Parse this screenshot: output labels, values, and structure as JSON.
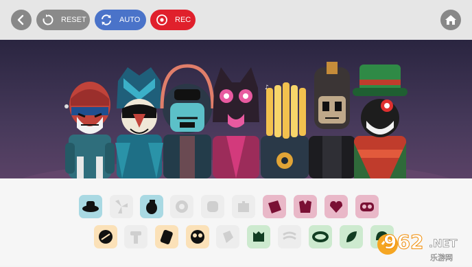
{
  "toolbar": {
    "reset_label": "RESET",
    "auto_label": "AUTO",
    "rec_label": "REC",
    "reset_color": "#8a8a8a",
    "auto_color": "#4a73c9",
    "rec_color": "#e0202c"
  },
  "stage": {
    "characters": [
      {
        "id": "c1",
        "role": "beats"
      },
      {
        "id": "c2",
        "role": "beats"
      },
      {
        "id": "c3",
        "role": "beats"
      },
      {
        "id": "c4",
        "role": "effects"
      },
      {
        "id": "c5",
        "role": "effects"
      },
      {
        "id": "c6",
        "role": "melodies"
      },
      {
        "id": "c7",
        "role": "voices"
      }
    ]
  },
  "sounds": {
    "row1": [
      {
        "icon": "hat-icon",
        "bg": "#a9d9e3",
        "active": true
      },
      {
        "icon": "fan-icon",
        "bg": "#ededed",
        "active": false
      },
      {
        "icon": "grenade-icon",
        "bg": "#a9d9e3",
        "active": true
      },
      {
        "icon": "gear-icon",
        "bg": "#ededed",
        "active": false
      },
      {
        "icon": "mask-icon",
        "bg": "#ededed",
        "active": false
      },
      {
        "icon": "puzzle-icon",
        "bg": "#ededed",
        "active": false
      },
      {
        "icon": "bag-icon",
        "bg": "#e9b8c8",
        "active": true
      },
      {
        "icon": "chest-icon",
        "bg": "#e9b8c8",
        "active": true
      },
      {
        "icon": "heart-icon",
        "bg": "#e9b8c8",
        "active": true
      },
      {
        "icon": "goggles-icon",
        "bg": "#e9b8c8",
        "active": true
      }
    ],
    "row2": [
      {
        "icon": "disc-icon",
        "bg": "#fbe1b8",
        "active": true
      },
      {
        "icon": "pipe-icon",
        "bg": "#ededed",
        "active": false
      },
      {
        "icon": "card-icon",
        "bg": "#fbe1b8",
        "active": true
      },
      {
        "icon": "face-icon",
        "bg": "#fbe1b8",
        "active": true
      },
      {
        "icon": "cube-icon",
        "bg": "#ededed",
        "active": false
      },
      {
        "icon": "monster-icon",
        "bg": "#cdeacf",
        "active": true
      },
      {
        "icon": "wave-icon",
        "bg": "#ededed",
        "active": false
      },
      {
        "icon": "ring-icon",
        "bg": "#cdeacf",
        "active": true
      },
      {
        "icon": "leaf-icon",
        "bg": "#cdeacf",
        "active": true
      },
      {
        "icon": "helmet-icon",
        "bg": "#cdeacf",
        "active": true
      }
    ]
  },
  "watermark": {
    "number": "962",
    "suffix": ".NET",
    "subtitle": "乐游网"
  }
}
